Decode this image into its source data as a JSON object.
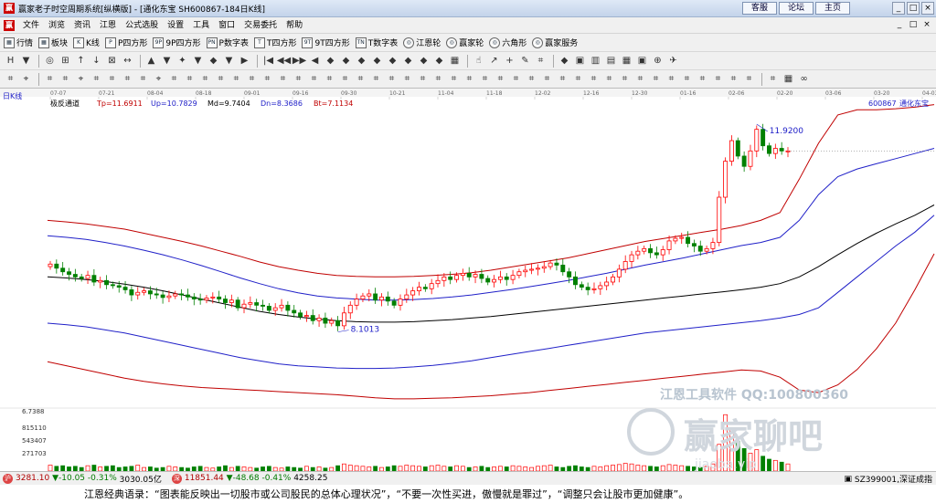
{
  "window": {
    "title": "赢家老子时空周期系统[纵横版] - [通化东宝  SH600867-184日K线]",
    "links": [
      "客服",
      "论坛",
      "主页"
    ],
    "buttons": [
      "_",
      "□",
      "×"
    ]
  },
  "menu": {
    "items": [
      "文件",
      "浏览",
      "资讯",
      "江恩",
      "公式选股",
      "设置",
      "工具",
      "窗口",
      "交易委托",
      "帮助"
    ],
    "mdi_buttons": [
      "_",
      "□",
      "×"
    ]
  },
  "toolbar1": {
    "items": [
      {
        "label": "行情",
        "icon": "grid-icon",
        "glyph": "▦"
      },
      {
        "label": "板块",
        "icon": "grid-icon",
        "glyph": "▦"
      },
      {
        "label": "K线",
        "icon": "kline-icon",
        "glyph": "K"
      },
      {
        "label": "P四方形",
        "icon": "p-square-icon",
        "glyph": "P"
      },
      {
        "label": "9P四方形",
        "icon": "9p-square-icon",
        "glyph": "9P"
      },
      {
        "label": "P数字表",
        "icon": "p-table-icon",
        "glyph": "PN"
      },
      {
        "label": "T四方形",
        "icon": "t-square-icon",
        "glyph": "T"
      },
      {
        "label": "9T四方形",
        "icon": "9t-square-icon",
        "glyph": "9T"
      },
      {
        "label": "T数字表",
        "icon": "t-table-icon",
        "glyph": "TN"
      },
      {
        "label": "江恩轮",
        "icon": "gann-wheel-icon",
        "glyph": "◎"
      },
      {
        "label": "赢家轮",
        "icon": "winner-wheel-icon",
        "glyph": "◎"
      },
      {
        "label": "六角形",
        "icon": "hexagon-icon",
        "glyph": "◎"
      },
      {
        "label": "赢家服务",
        "icon": "service-icon",
        "glyph": "◎"
      }
    ]
  },
  "toolbar2": {
    "glyphs": [
      "H",
      "▼",
      "◎",
      "⊞",
      "↑",
      "↓",
      "⊠",
      "↔",
      "▲",
      "▼",
      "✦",
      "▼",
      "◆",
      "▼",
      "▶",
      "|◀",
      "◀◀",
      "▶▶",
      "◀",
      "◆",
      "◆",
      "◆",
      "◆",
      "◆",
      "◆",
      "◆",
      "◆",
      "▦",
      "☝",
      "↗",
      "+",
      "✎",
      "⌗",
      "◆",
      "▣",
      "▥",
      "▤",
      "▦",
      "▣",
      "⊕",
      "✈"
    ]
  },
  "toolbar3": {
    "glyphs": [
      "⌗",
      "⌖",
      "⌗",
      "⌗",
      "⌖",
      "⌗",
      "⌗",
      "⌗",
      "⌗",
      "⌖",
      "⌗",
      "⌗",
      "⌗",
      "⌗",
      "⌗",
      "⌗",
      "⌗",
      "⌗",
      "⌗",
      "⌗",
      "⌗",
      "⌗",
      "⌗",
      "⌗",
      "⌗",
      "⌗",
      "⌗",
      "⌗",
      "⌗",
      "⌗",
      "⌗",
      "⌗",
      "⌗",
      "⌗",
      "⌗",
      "⌗",
      "⌗",
      "⌗",
      "⌗",
      "⌗",
      "⌗",
      "⌗",
      "⌗",
      "⌗",
      "⌗",
      "⌗",
      "⌗",
      "⌗",
      "⌗",
      "▦",
      "∞"
    ]
  },
  "chart_data": {
    "type": "candlestick",
    "period_label": "日K线",
    "stock": {
      "code": "600867",
      "name": "通化东宝"
    },
    "date_ticks": [
      "07-07",
      "07-21",
      "08-04",
      "08-18",
      "09-01",
      "09-16",
      "09-30",
      "10-21",
      "11-04",
      "11-18",
      "12-02",
      "12-16",
      "12-30",
      "01-16",
      "02-06",
      "02-20",
      "03-06",
      "03-20",
      "04-03"
    ],
    "indicator": {
      "name": "极反通道",
      "Tp": "Tp=11.6911",
      "Up": "Up=10.7829",
      "Md": "Md=9.7404",
      "Dn": "Dn=8.3686",
      "Bt": "Bt=7.1134"
    },
    "price_labels": {
      "high": "11.9200",
      "low": "8.1013"
    },
    "volume_axis": [
      "6.7388",
      "815110",
      "543407",
      "271703"
    ],
    "watermark": {
      "line1": "江恩工具软件  QQ:100800360",
      "line2": "赢家聊吧",
      "line3": "jiaoba.vip"
    },
    "y_range": [
      6.5,
      12.5
    ],
    "colors": {
      "up": "#ff0000",
      "down": "#008000",
      "tp": "#c00000",
      "up_line": "#2020c8",
      "md": "#000000"
    },
    "series": {
      "close": [
        9.3,
        9.22,
        9.15,
        9.1,
        9.05,
        9.02,
        9.08,
        8.95,
        8.98,
        8.9,
        8.88,
        8.85,
        8.8,
        8.7,
        8.75,
        8.78,
        8.72,
        8.7,
        8.65,
        8.68,
        8.72,
        8.7,
        8.66,
        8.62,
        8.6,
        8.64,
        8.66,
        8.62,
        8.55,
        8.6,
        8.45,
        8.52,
        8.55,
        8.5,
        8.48,
        8.4,
        8.45,
        8.5,
        8.4,
        8.35,
        8.28,
        8.3,
        8.2,
        8.25,
        8.15,
        8.2,
        8.1,
        8.35,
        8.5,
        8.62,
        8.68,
        8.72,
        8.6,
        8.66,
        8.58,
        8.5,
        8.62,
        8.7,
        8.78,
        8.85,
        8.82,
        8.92,
        8.98,
        9.05,
        9.0,
        9.08,
        9.12,
        9.05,
        9.1,
        9.02,
        8.95,
        9.0,
        9.05,
        9.0,
        9.08,
        9.15,
        9.18,
        9.2,
        9.22,
        9.25,
        9.32,
        9.28,
        9.15,
        9.05,
        8.9,
        8.85,
        8.8,
        8.82,
        8.88,
        8.95,
        9.05,
        9.2,
        9.35,
        9.48,
        9.55,
        9.6,
        9.52,
        9.48,
        9.58,
        9.75,
        9.8,
        9.82,
        9.7,
        9.65,
        9.55,
        9.6,
        9.72,
        10.6,
        11.3,
        11.7,
        11.4,
        11.2,
        11.5,
        11.92,
        11.6,
        11.45,
        11.55,
        11.5,
        11.5
      ],
      "tp": [
        10.15,
        10.12,
        10.08,
        10.03,
        9.98,
        9.9,
        9.82,
        9.74,
        9.65,
        9.55,
        9.45,
        9.34,
        9.25,
        9.18,
        9.12,
        9.08,
        9.06,
        9.05,
        9.05,
        9.06,
        9.08,
        9.1,
        9.13,
        9.18,
        9.24,
        9.3,
        9.36,
        9.42,
        9.5,
        9.58,
        9.66,
        9.74,
        9.8,
        9.86,
        9.92,
        9.98,
        10.05,
        10.15,
        10.3,
        10.95,
        11.65,
        12.2,
        12.3,
        12.3,
        12.32,
        12.35,
        12.4
      ],
      "up_line": [
        9.85,
        9.82,
        9.78,
        9.72,
        9.65,
        9.57,
        9.48,
        9.38,
        9.27,
        9.15,
        9.03,
        8.92,
        8.82,
        8.74,
        8.68,
        8.64,
        8.62,
        8.6,
        8.6,
        8.61,
        8.63,
        8.66,
        8.7,
        8.75,
        8.8,
        8.86,
        8.92,
        8.98,
        9.05,
        9.12,
        9.2,
        9.28,
        9.35,
        9.42,
        9.5,
        9.58,
        9.66,
        9.72,
        9.82,
        10.15,
        10.65,
        11.0,
        11.15,
        11.25,
        11.35,
        11.45,
        11.55
      ],
      "md": [
        9.05,
        9.03,
        9.0,
        8.96,
        8.91,
        8.85,
        8.78,
        8.7,
        8.62,
        8.54,
        8.46,
        8.38,
        8.32,
        8.27,
        8.23,
        8.2,
        8.18,
        8.17,
        8.17,
        8.18,
        8.2,
        8.22,
        8.25,
        8.28,
        8.32,
        8.36,
        8.4,
        8.44,
        8.48,
        8.52,
        8.56,
        8.6,
        8.64,
        8.68,
        8.72,
        8.76,
        8.8,
        8.85,
        8.92,
        9.05,
        9.25,
        9.48,
        9.7,
        9.9,
        10.08,
        10.25,
        10.45
      ],
      "dn": [
        8.15,
        8.12,
        8.08,
        8.02,
        7.96,
        7.88,
        7.8,
        7.72,
        7.64,
        7.56,
        7.48,
        7.42,
        7.36,
        7.32,
        7.3,
        7.28,
        7.27,
        7.27,
        7.28,
        7.3,
        7.33,
        7.37,
        7.42,
        7.48,
        7.54,
        7.6,
        7.66,
        7.72,
        7.78,
        7.84,
        7.9,
        7.96,
        8.0,
        8.04,
        8.08,
        8.12,
        8.16,
        8.2,
        8.25,
        8.32,
        8.45,
        8.75,
        9.05,
        9.35,
        9.65,
        9.92,
        10.25
      ],
      "bt": [
        7.4,
        7.32,
        7.24,
        7.16,
        7.08,
        7.02,
        6.97,
        6.93,
        6.9,
        6.88,
        6.86,
        6.84,
        6.82,
        6.8,
        6.78,
        6.76,
        6.73,
        6.7,
        6.68,
        6.68,
        6.69,
        6.7,
        6.72,
        6.74,
        6.77,
        6.8,
        6.84,
        6.88,
        6.92,
        6.96,
        7.0,
        7.04,
        7.08,
        7.12,
        7.16,
        7.2,
        7.24,
        7.22,
        7.1,
        6.85,
        6.8,
        6.95,
        7.25,
        7.65,
        8.15,
        8.8,
        9.5
      ],
      "volume": [
        0.1,
        0.08,
        0.09,
        0.07,
        0.08,
        0.06,
        0.09,
        0.1,
        0.07,
        0.08,
        0.09,
        0.06,
        0.07,
        0.08,
        0.1,
        0.06,
        0.07,
        0.05,
        0.06,
        0.08,
        0.07,
        0.06,
        0.05,
        0.07,
        0.08,
        0.06,
        0.05,
        0.07,
        0.09,
        0.06,
        0.08,
        0.07,
        0.06,
        0.05,
        0.07,
        0.08,
        0.06,
        0.05,
        0.07,
        0.06,
        0.05,
        0.08,
        0.06,
        0.07,
        0.05,
        0.06,
        0.09,
        0.12,
        0.1,
        0.09,
        0.08,
        0.07,
        0.08,
        0.06,
        0.07,
        0.09,
        0.08,
        0.1,
        0.09,
        0.08,
        0.07,
        0.09,
        0.1,
        0.08,
        0.07,
        0.09,
        0.08,
        0.06,
        0.07,
        0.08,
        0.06,
        0.07,
        0.08,
        0.07,
        0.09,
        0.08,
        0.07,
        0.06,
        0.08,
        0.09,
        0.1,
        0.07,
        0.06,
        0.08,
        0.09,
        0.07,
        0.06,
        0.08,
        0.07,
        0.09,
        0.1,
        0.11,
        0.13,
        0.12,
        0.1,
        0.09,
        0.08,
        0.07,
        0.09,
        0.11,
        0.1,
        0.09,
        0.08,
        0.07,
        0.06,
        0.08,
        0.12,
        0.45,
        0.95,
        0.7,
        0.5,
        0.38,
        0.3,
        0.36,
        0.25,
        0.2,
        0.18,
        0.15,
        0.12
      ]
    }
  },
  "status": {
    "sh": {
      "value": "3281.10",
      "change": "▼-10.05",
      "pct": "-0.31%",
      "amount": "3030.05亿"
    },
    "sz": {
      "value": "11851.44",
      "change": "▼-48.68",
      "pct": "-0.41%",
      "amount": "4258.25"
    },
    "right_label": "SZ399001,深证成指"
  },
  "quote": "江恩经典语录：“图表能反映出一切股市或公司股民的总体心理状况”，“不要一次性买进，傲慢就是罪过”，“调整只会让股市更加健康”。"
}
